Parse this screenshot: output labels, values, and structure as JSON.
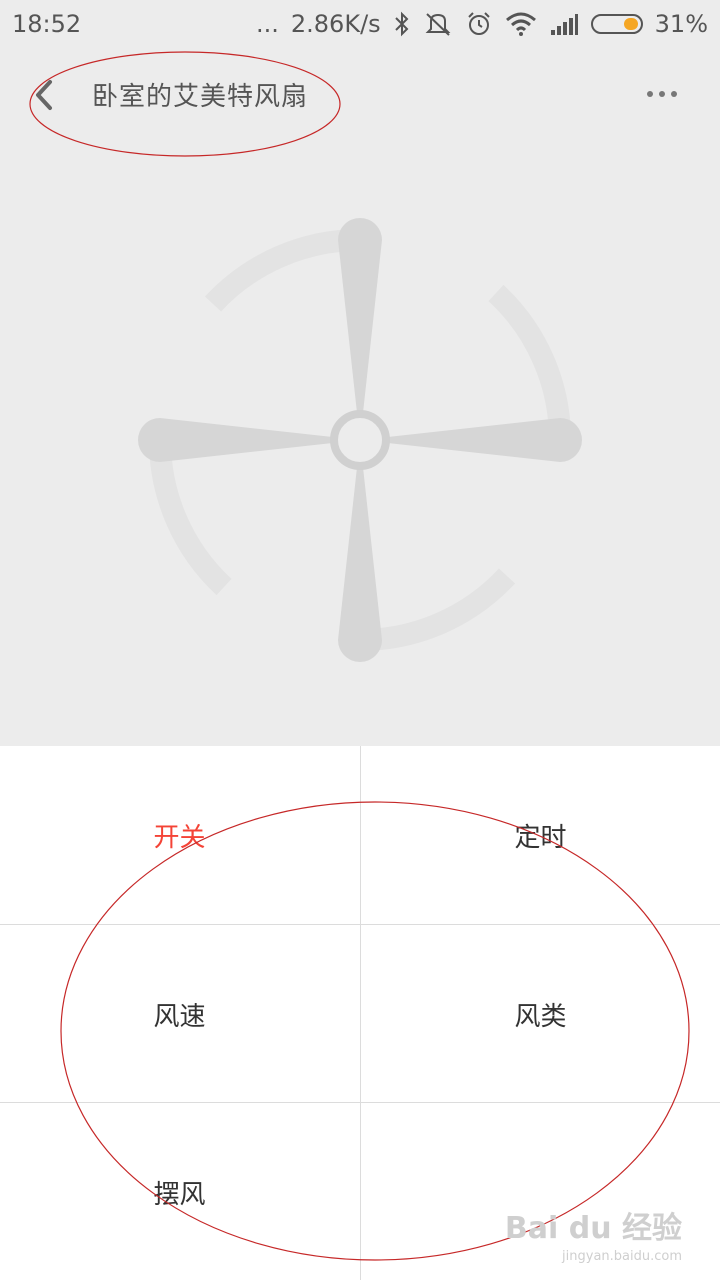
{
  "status_bar": {
    "time": "18:52",
    "more": "...",
    "network_speed": "2.86K/s",
    "battery_percent": "31%",
    "battery_level": 0.31,
    "battery_color": "#f5a623",
    "icons": [
      "bluetooth-icon",
      "mute-vibrate-icon",
      "alarm-icon",
      "wifi-icon",
      "signal-icon",
      "battery-icon"
    ]
  },
  "header": {
    "title": "卧室的艾美特风扇",
    "back_icon": "back-arrow-icon",
    "more_icon": "more-dots-icon"
  },
  "controls": [
    {
      "label": "开关",
      "active": true
    },
    {
      "label": "定时",
      "active": false
    },
    {
      "label": "风速",
      "active": false
    },
    {
      "label": "风类",
      "active": false
    },
    {
      "label": "摆风",
      "active": false
    },
    {
      "label": "",
      "active": false
    }
  ],
  "colors": {
    "accent_active": "#f44336",
    "annotation": "#c62828",
    "top_background": "#ececec"
  },
  "watermark": {
    "brand": "Bai du 经验",
    "url": "jingyan.baidu.com"
  }
}
